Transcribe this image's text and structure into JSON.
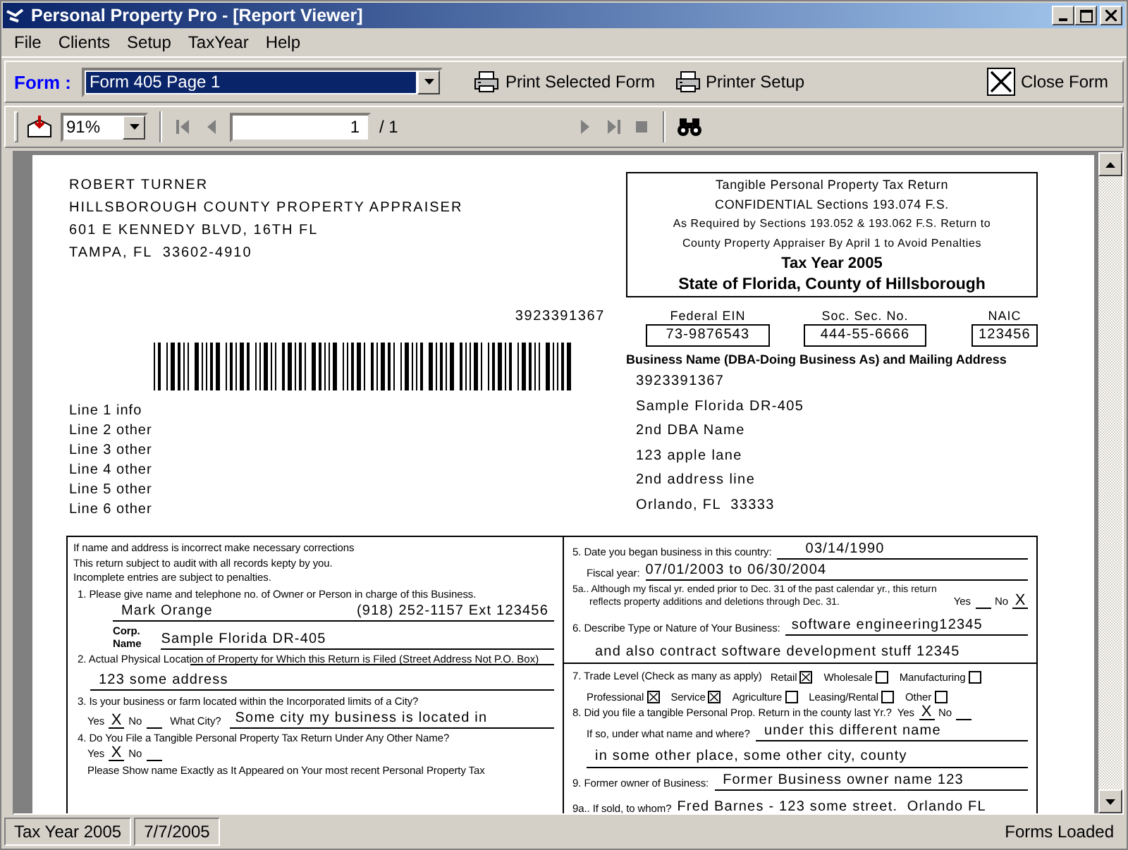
{
  "window": {
    "title": "Personal Property Pro - [Report Viewer]"
  },
  "menu": [
    "File",
    "Clients",
    "Setup",
    "TaxYear",
    "Help"
  ],
  "form_bar": {
    "label": "Form :",
    "selected_form": "Form 405 Page 1",
    "print_buttons": [
      "Print Selected Form",
      "Printer Setup"
    ],
    "close": "Close Form"
  },
  "viewer_bar": {
    "zoom": "91%",
    "page": "1",
    "page_total": "/ 1"
  },
  "report": {
    "appraiser": [
      "ROBERT TURNER",
      "HILLSBOROUGH COUNTY PROPERTY APPRAISER",
      "601 E KENNEDY BLVD, 16TH FL",
      "TAMPA, FL  33602-4910"
    ],
    "barcode_number": "3923391367",
    "mail_lines": [
      "Line 1 info",
      "Line 2 other",
      "Line 3 other",
      "Line 4 other",
      "Line 5 other",
      "Line 6 other"
    ],
    "header": {
      "lines": [
        "Tangible Personal Property Tax Return",
        "CONFIDENTIAL Sections 193.074 F.S.",
        "As Required by Sections 193.052 & 193.062 F.S. Return to",
        "County Property Appraiser By April 1 to Avoid Penalties"
      ],
      "tax_year": "Tax Year 2005",
      "state": "State of Florida, County of Hillsborough"
    },
    "ids": [
      {
        "label": "Federal EIN",
        "value": "73-9876543"
      },
      {
        "label": "Soc. Sec. No.",
        "value": "444-55-6666"
      },
      {
        "label": "NAIC",
        "value": "123456"
      }
    ],
    "business_heading": "Business Name (DBA-Doing Business As) and Mailing Address",
    "business_lines": [
      "3923391367",
      "Sample Florida DR-405",
      "2nd DBA Name",
      "123 apple lane",
      "2nd address line",
      "Orlando, FL  33333"
    ],
    "form": {
      "notes": [
        "If name and address is incorrect make necessary corrections",
        "This return subject to audit with all records kepty by you.",
        "Incomplete entries are subject to penalties."
      ],
      "owner": {
        "question": "1. Please give name and telephone no. of Owner or Person in charge of this Business.",
        "name": "Mark Orange",
        "phone": "(918) 252-1157 Ext 123456"
      },
      "corp": {
        "label_lines": [
          "Corp.",
          "Name"
        ],
        "value": "Sample Florida DR-405"
      },
      "location": {
        "question": "2. Actual Physical Location of Property for Which this Return is Filed (Street Address Not P.O. Box)",
        "value": "123 some address"
      },
      "city": {
        "question": "3. Is your business or farm located within the Incorporated limits of a City?",
        "options": [
          {
            "label": "Yes",
            "mark": "X"
          },
          {
            "label": "No"
          }
        ],
        "city_label": "What City?",
        "value": "Some city my business is located in"
      },
      "other_name": {
        "question": "4. Do You File a Tangible Personal Property Tax Return Under Any Other Name?",
        "options": [
          {
            "label": "Yes",
            "mark": "X"
          },
          {
            "label": "No"
          }
        ],
        "note": "Please Show name Exactly as It Appeared on Your most recent Personal Property Tax"
      },
      "began": {
        "label": "5. Date you began business in this country:",
        "value": "03/14/1990"
      },
      "fiscal": {
        "label": "Fiscal year:",
        "value": "07/01/2003 to 06/30/2004"
      },
      "calendar": {
        "question": "5a.. Although my fiscal yr. ended prior to Dec. 31 of the past calendar yr., this return reflects property additions and deletions through Dec. 31.",
        "options": [
          {
            "label": "Yes"
          },
          {
            "label": "No",
            "mark": "X"
          }
        ]
      },
      "nature": {
        "label": "6. Describe Type or Nature of Your Business:",
        "value": "software engineering12345",
        "continuation": "and also contract software development stuff 12345"
      },
      "trade": {
        "label": "7. Trade Level (Check as many as apply)",
        "options": [
          {
            "label": "Retail",
            "checked": true
          },
          {
            "label": "Wholesale",
            "checked": false
          },
          {
            "label": "Manufacturing",
            "checked": false
          },
          {
            "label": "Professional",
            "checked": true
          },
          {
            "label": "Service",
            "checked": true
          },
          {
            "label": "Agriculture",
            "checked": false
          },
          {
            "label": "Leasing/Rental",
            "checked": false
          },
          {
            "label": "Other",
            "checked": false
          }
        ]
      },
      "last_year": {
        "question": "8. Did you file a tangible Personal Prop. Return in the county last Yr.?",
        "options": [
          {
            "label": "Yes",
            "mark": "X"
          },
          {
            "label": "No"
          }
        ],
        "where_label": "If so, under what name and where?",
        "value": "under this different name",
        "continuation": "in some other place, some other city, county"
      },
      "former_owner": {
        "label": "9. Former owner of Business:",
        "value": "Former Business owner name 123"
      },
      "sold_to": {
        "label": "9a.. If sold, to whom?",
        "value": "Fred Barnes - 123 some street.  Orlando FL"
      }
    }
  },
  "status_bar": [
    "Tax Year 2005",
    "7/7/2005",
    "Forms Loaded"
  ]
}
